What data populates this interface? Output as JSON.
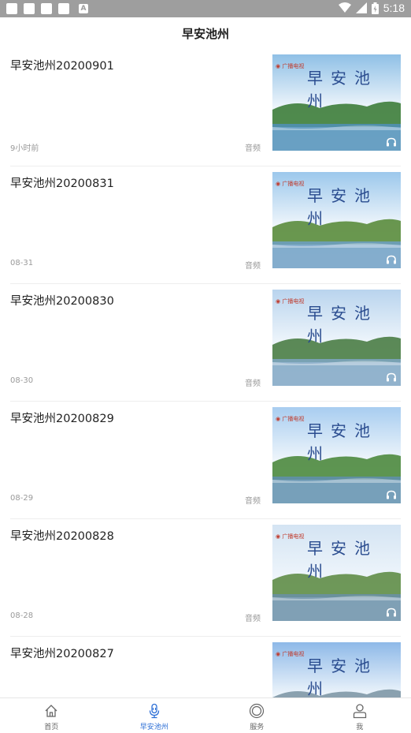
{
  "status_bar": {
    "time": "5:18",
    "app_icon": "A"
  },
  "header": {
    "title": "早安池州"
  },
  "thumbnail": {
    "logo_text": "◉ 广播电视",
    "title_text": "早安池州"
  },
  "items": [
    {
      "title": "早安池州20200901",
      "date": "9小时前",
      "type": "音频"
    },
    {
      "title": "早安池州20200831",
      "date": "08-31",
      "type": "音频"
    },
    {
      "title": "早安池州20200830",
      "date": "08-30",
      "type": "音频"
    },
    {
      "title": "早安池州20200829",
      "date": "08-29",
      "type": "音频"
    },
    {
      "title": "早安池州20200828",
      "date": "08-28",
      "type": "音频"
    },
    {
      "title": "早安池州20200827",
      "date": "",
      "type": ""
    }
  ],
  "nav": [
    {
      "label": "首页",
      "icon": "home-icon"
    },
    {
      "label": "早安池州",
      "icon": "microphone-icon",
      "active": true
    },
    {
      "label": "服务",
      "icon": "service-icon"
    },
    {
      "label": "我",
      "icon": "user-icon"
    }
  ],
  "colors": {
    "accent": "#2d6fd6",
    "status_bar": "#9e9e9e",
    "thumb_title": "#2a4c8f"
  }
}
